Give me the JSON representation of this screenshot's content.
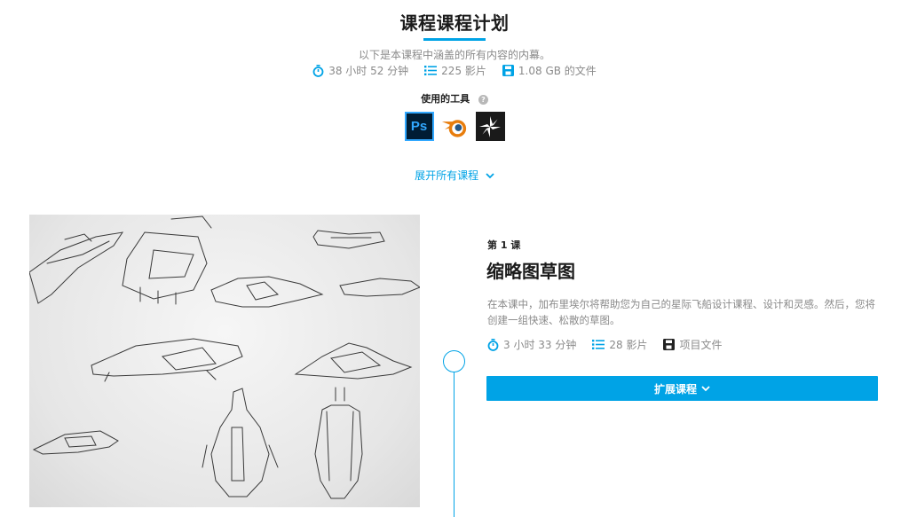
{
  "header": {
    "title": "课程课程计划",
    "subtitle": "以下是本课程中涵盖的所有内容的内幕。",
    "stats": {
      "duration": "38 小时 52 分钟",
      "videos": "225 影片",
      "files": "1.08 GB 的文件"
    }
  },
  "tools": {
    "label": "使用的工具",
    "help_glyph": "?",
    "items": [
      {
        "name": "photoshop-icon",
        "glyph": "Ps"
      },
      {
        "name": "blender-icon"
      },
      {
        "name": "keyshot-icon"
      }
    ]
  },
  "expand_all_label": "展开所有课程",
  "lesson": {
    "number": "第 1 课",
    "title": "缩略图草图",
    "description": "在本课中，加布里埃尔将帮助您为自己的星际飞船设计课程、设计和灵感。然后，您将创建一组快速、松散的草图。",
    "stats": {
      "duration": "3 小时 33 分钟",
      "videos": "28 影片",
      "files": "项目文件"
    },
    "expand_label": "扩展课程"
  },
  "colors": {
    "accent": "#00a3e6",
    "muted_text": "#8a8a8a"
  }
}
